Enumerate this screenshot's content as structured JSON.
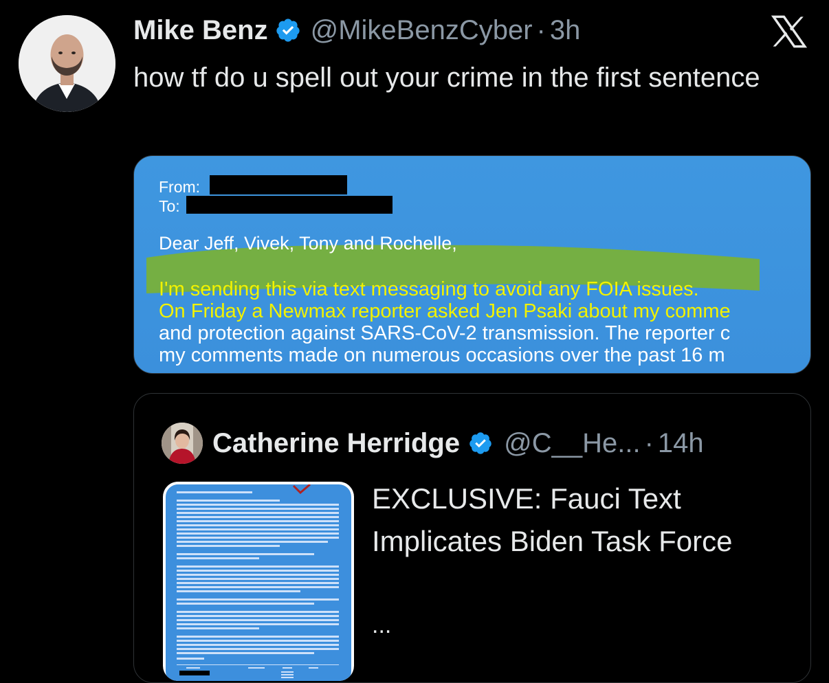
{
  "tweet": {
    "author_name": "Mike Benz",
    "author_handle": "@MikeBenzCyber",
    "separator": "·",
    "time": "3h",
    "text": "how tf do u spell out your crime in the first sentence"
  },
  "media_document": {
    "from_label": "From:",
    "to_label": "To:",
    "greeting": "Dear Jeff, Vivek, Tony and Rochelle,",
    "line1": "I'm sending this via text messaging to avoid any FOIA issues.",
    "line2": "On Friday a Newmax reporter asked Jen Psaki about my comme",
    "line3": "and protection against SARS-CoV-2 transmission. The reporter c",
    "line4": "my comments made on numerous occasions over the past 16 m",
    "highlight_color": "#7ab13a",
    "text_color_highlight": "#f2f200",
    "text_color_plain": "#ffffff"
  },
  "quote": {
    "author_name": "Catherine Herridge",
    "author_handle": "@C__He...",
    "separator": "·",
    "time": "14h",
    "title": "EXCLUSIVE: Fauci Text Implicates Biden Task Force",
    "more": "..."
  },
  "colors": {
    "background": "#000000",
    "text_primary": "#e7e9ea",
    "text_secondary": "#8b98a5",
    "verified": "#1d9bf0",
    "border": "#2f3336"
  },
  "icons": {
    "verified": "verified-badge-icon",
    "brand": "x-logo-icon"
  }
}
